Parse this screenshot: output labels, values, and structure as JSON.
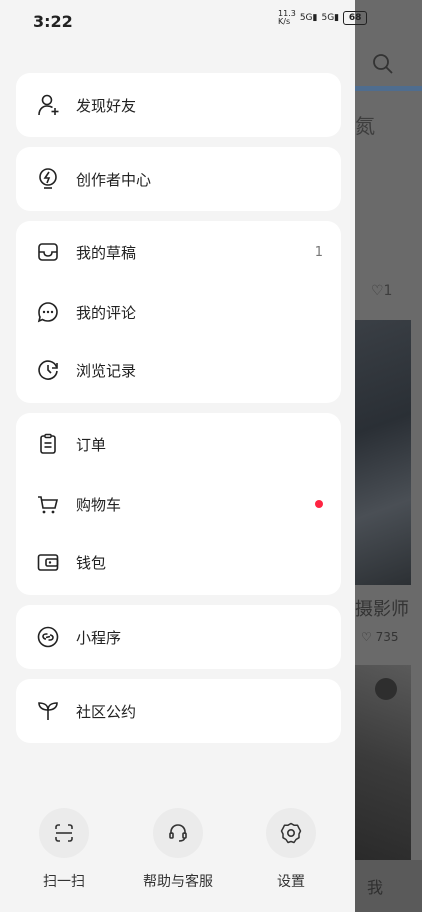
{
  "status_bar": {
    "time": "3:22",
    "net_speed": "11.3\nK/s",
    "signal_1": "5G",
    "signal_2": "5G",
    "battery": "68"
  },
  "background": {
    "text1": "氮",
    "title2": "摄影师",
    "likes2": "♡ 735",
    "tab_me": "我"
  },
  "menu": {
    "discover_friends": "发现好友",
    "creator_center": "创作者中心",
    "my_drafts": "我的草稿",
    "my_drafts_count": "1",
    "my_comments": "我的评论",
    "history": "浏览记录",
    "orders": "订单",
    "cart": "购物车",
    "wallet": "钱包",
    "mini_programs": "小程序",
    "community": "社区公约"
  },
  "bottom_bar": {
    "scan": "扫一扫",
    "help": "帮助与客服",
    "settings": "设置"
  },
  "colors": {
    "accent_dot": "#ff2442",
    "drawer_bg": "#f4f4f4",
    "card_bg": "#ffffff"
  }
}
